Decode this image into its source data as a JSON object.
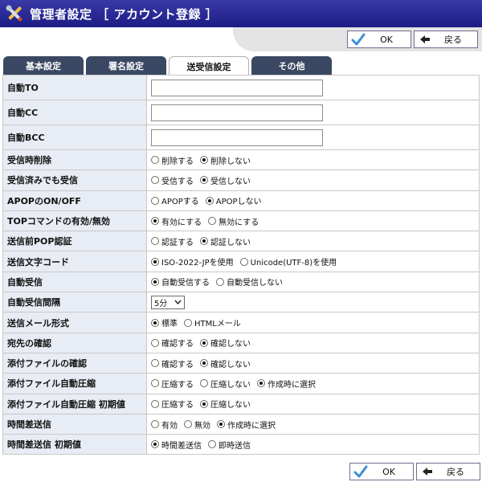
{
  "header": {
    "title": "管理者設定 ［ アカウント登録 ］",
    "icon": "tools-icon",
    "bg_color": "#1c1c86"
  },
  "buttons": {
    "ok_label": "OK",
    "back_label": "戻る",
    "ok_icon": "checkmark-icon",
    "back_icon": "arrow-left-icon"
  },
  "tabs": [
    {
      "label": "基本設定",
      "active": false
    },
    {
      "label": "署名設定",
      "active": false
    },
    {
      "label": "送受信設定",
      "active": true
    },
    {
      "label": "その他",
      "active": false
    }
  ],
  "fields": {
    "auto_to": {
      "label": "自動TO",
      "value": ""
    },
    "auto_cc": {
      "label": "自動CC",
      "value": ""
    },
    "auto_bcc": {
      "label": "自動BCC",
      "value": ""
    }
  },
  "rows": [
    {
      "label": "受信時削除",
      "options": [
        "削除する",
        "削除しない"
      ],
      "selected": 1
    },
    {
      "label": "受信済みでも受信",
      "options": [
        "受信する",
        "受信しない"
      ],
      "selected": 1
    },
    {
      "label": "APOPのON/OFF",
      "options": [
        "APOPする",
        "APOPしない"
      ],
      "selected": 1
    },
    {
      "label": "TOPコマンドの有効/無効",
      "options": [
        "有効にする",
        "無効にする"
      ],
      "selected": 0
    },
    {
      "label": "送信前POP認証",
      "options": [
        "認証する",
        "認証しない"
      ],
      "selected": 1
    },
    {
      "label": "送信文字コード",
      "options": [
        "ISO-2022-JPを使用",
        "Unicode(UTF-8)を使用"
      ],
      "selected": 0
    },
    {
      "label": "自動受信",
      "options": [
        "自動受信する",
        "自動受信しない"
      ],
      "selected": 0
    },
    {
      "label": "自動受信間隔",
      "select_value": "5分"
    },
    {
      "label": "送信メール形式",
      "options": [
        "標準",
        "HTMLメール"
      ],
      "selected": 0
    },
    {
      "label": "宛先の確認",
      "options": [
        "確認する",
        "確認しない"
      ],
      "selected": 1
    },
    {
      "label": "添付ファイルの確認",
      "options": [
        "確認する",
        "確認しない"
      ],
      "selected": 1
    },
    {
      "label": "添付ファイル自動圧縮",
      "options": [
        "圧縮する",
        "圧縮しない",
        "作成時に選択"
      ],
      "selected": 2
    },
    {
      "label": "添付ファイル自動圧縮 初期値",
      "options": [
        "圧縮する",
        "圧縮しない"
      ],
      "selected": 1
    },
    {
      "label": "時間差送信",
      "options": [
        "有効",
        "無効",
        "作成時に選択"
      ],
      "selected": 2
    },
    {
      "label": "時間差送信 初期値",
      "options": [
        "時間差送信",
        "即時送信"
      ],
      "selected": 0
    }
  ]
}
